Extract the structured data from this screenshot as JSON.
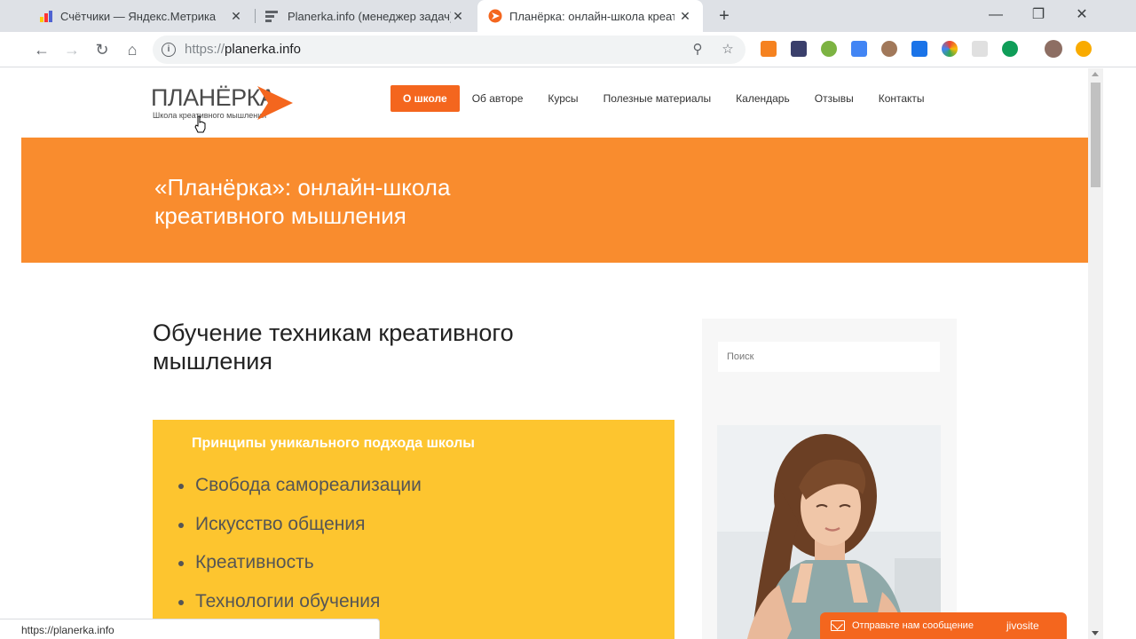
{
  "browser": {
    "tabs": [
      {
        "title": "Счётчики — Яндекс.Метрика",
        "active": false
      },
      {
        "title": "Planerka.info (менеджер задач)",
        "active": false
      },
      {
        "title": "Планёрка: онлайн-школа креат",
        "active": true
      }
    ],
    "url_protocol": "https://",
    "url_host": "planerka.info",
    "status_url": "https://planerka.info"
  },
  "site": {
    "logo_text": "ПЛАНЁРКА",
    "logo_subtitle": "Школа креативного мышления",
    "nav": [
      {
        "label": "О школе",
        "active": true
      },
      {
        "label": "Об авторе",
        "active": false
      },
      {
        "label": "Курсы",
        "active": false
      },
      {
        "label": "Полезные материалы",
        "active": false
      },
      {
        "label": "Календарь",
        "active": false
      },
      {
        "label": "Отзывы",
        "active": false
      },
      {
        "label": "Контакты",
        "active": false
      }
    ],
    "hero_title_line1": "«Планёрка»: онлайн-школа",
    "hero_title_line2": "креативного мышления",
    "section_title_line1": "Обучение техникам креативного",
    "section_title_line2": "мышления",
    "principles_title": "Принципы уникального подхода школы",
    "principles": [
      "Свобода самореализации",
      "Искусство общения",
      "Креативность",
      "Технологии обучения"
    ],
    "search_placeholder": "Поиск",
    "chat_text": "Отправьте нам сообщение",
    "chat_brand": "jivosite"
  },
  "colors": {
    "accent_orange": "#f4661e",
    "hero_orange": "#f98c2e",
    "principles_yellow": "#fdc52f"
  }
}
